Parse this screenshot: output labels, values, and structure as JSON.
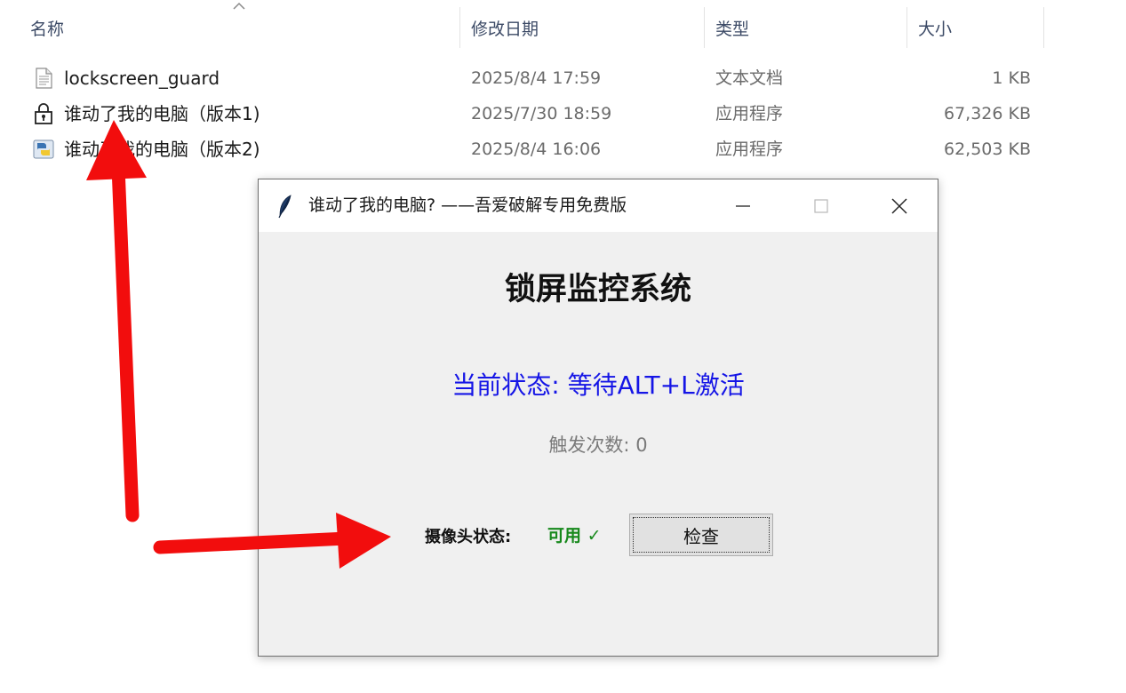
{
  "explorer": {
    "columns": {
      "name": "名称",
      "modified": "修改日期",
      "type": "类型",
      "size": "大小"
    },
    "files": [
      {
        "name": "lockscreen_guard",
        "modified": "2025/8/4 17:59",
        "type": "文本文档",
        "size": "1 KB",
        "icon": "text-file-icon"
      },
      {
        "name": "谁动了我的电脑（版本1)",
        "modified": "2025/7/30 18:59",
        "type": "应用程序",
        "size": "67,326 KB",
        "icon": "lock-app-icon"
      },
      {
        "name": "谁动了我的电脑（版本2)",
        "modified": "2025/8/4 16:06",
        "type": "应用程序",
        "size": "62,503 KB",
        "icon": "python-app-icon"
      }
    ]
  },
  "window": {
    "title": "谁动了我的电脑? ——吾爱破解专用免费版",
    "heading": "锁屏监控系统",
    "status": "当前状态: 等待ALT+L激活",
    "trigger_count": "触发次数: 0",
    "camera_label": "摄像头状态:",
    "camera_value": "可用 ✓",
    "check_button": "检查"
  },
  "colors": {
    "status_text": "#1515e6",
    "camera_ok": "#17891c",
    "annotation_arrow": "#f20d0d"
  }
}
